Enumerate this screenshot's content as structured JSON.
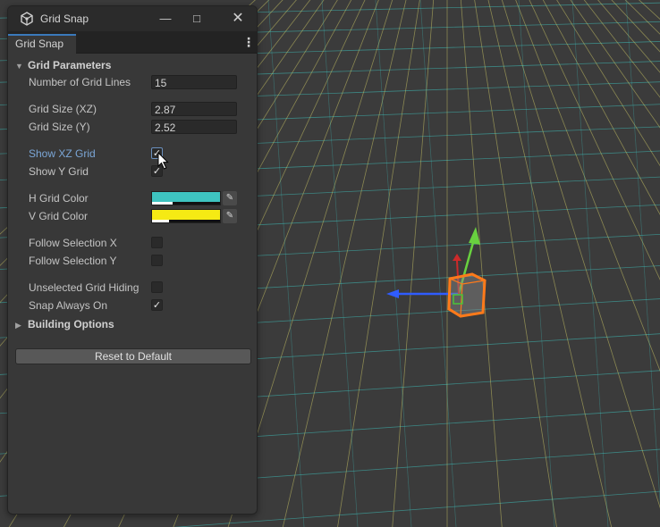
{
  "window": {
    "title": "Grid Snap",
    "tab_label": "Grid Snap",
    "icons": {
      "app": "unity-cube-icon",
      "minimize": "minimize-icon",
      "maximize": "maximize-icon",
      "close": "close-icon",
      "menu": "kebab-menu-icon"
    }
  },
  "grid_parameters": {
    "header": "Grid Parameters",
    "expanded": true,
    "number_of_grid_lines": {
      "label": "Number of Grid Lines",
      "value": "15"
    },
    "grid_size_xz": {
      "label": "Grid Size (XZ)",
      "value": "2.87"
    },
    "grid_size_y": {
      "label": "Grid Size (Y)",
      "value": "2.52"
    },
    "show_xz_grid": {
      "label": "Show XZ Grid",
      "checked": true
    },
    "show_y_grid": {
      "label": "Show Y Grid",
      "checked": true
    },
    "h_grid_color": {
      "label": "H Grid Color",
      "color": "#3ec4c0",
      "alpha": 0.3
    },
    "v_grid_color": {
      "label": "V Grid Color",
      "color": "#f5ea14",
      "alpha": 0.25
    },
    "follow_selection_x": {
      "label": "Follow Selection X",
      "checked": false
    },
    "follow_selection_y": {
      "label": "Follow Selection Y",
      "checked": false
    },
    "unselected_grid_hiding": {
      "label": "Unselected Grid Hiding",
      "checked": false
    },
    "snap_always_on": {
      "label": "Snap Always On",
      "checked": true
    }
  },
  "building_options": {
    "header": "Building Options",
    "expanded": false
  },
  "reset_button": {
    "label": "Reset to Default"
  },
  "scene": {
    "background": "#3b3b3b",
    "h_grid_line_color": "#3ec4c0",
    "v_grid_line_color": "#d9d36a",
    "gizmo": {
      "x_axis_color": "#2f5cff",
      "y_axis_color": "#69d13f",
      "z_axis_color": "#cc2a2a",
      "selection_outline": "#ff7a1a"
    }
  }
}
